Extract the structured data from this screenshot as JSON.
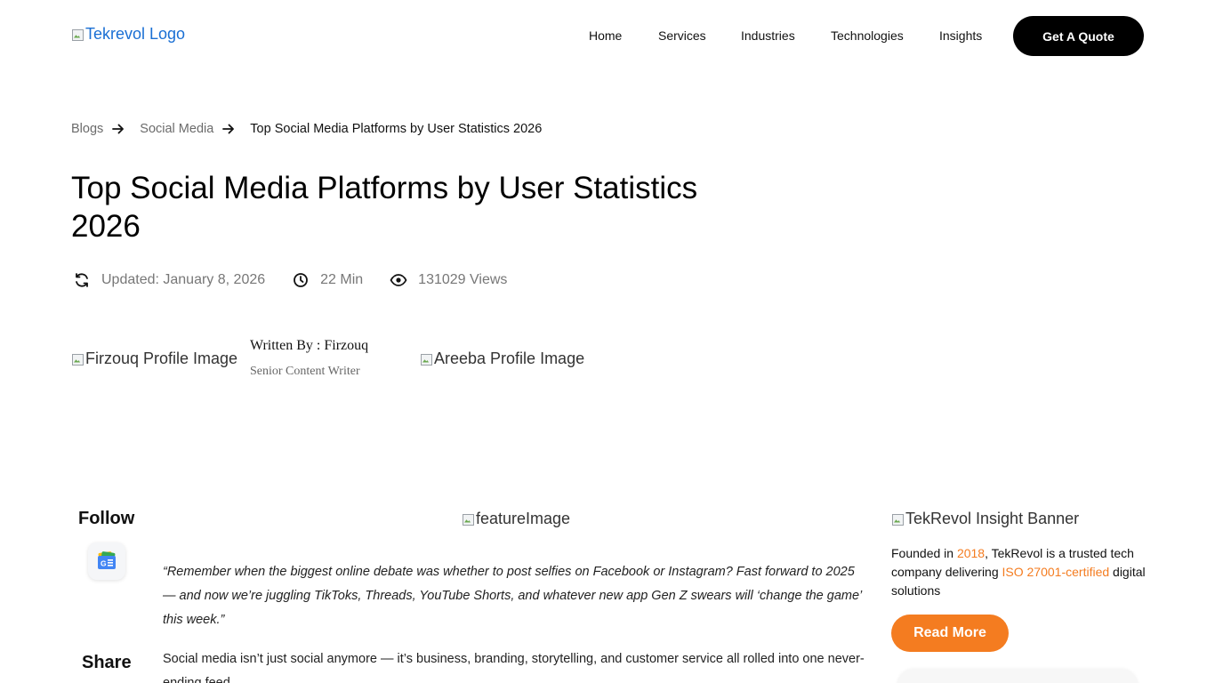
{
  "header": {
    "logo_alt": "Tekrevol Logo",
    "nav": [
      {
        "label": "Home"
      },
      {
        "label": "Services"
      },
      {
        "label": "Industries"
      },
      {
        "label": "Technologies"
      },
      {
        "label": "Insights"
      }
    ],
    "cta_label": "Get A Quote"
  },
  "breadcrumb": {
    "items": [
      "Blogs",
      "Social Media"
    ],
    "current": "Top Social Media Platforms by User Statistics 2026"
  },
  "article": {
    "title": "Top Social Media Platforms by User Statistics 2026",
    "updated": "Updated: January 8, 2026",
    "read_time": "22 Min",
    "views": "131029 Views",
    "author_image_alt": "Firzouq Profile Image",
    "author_name": "Written By : Firzouq",
    "author_role": "Senior Content Writer",
    "reviewer_image_alt": "Areeba Profile Image",
    "feature_image_alt": "featureImage",
    "quote": "“Remember when the biggest online debate was whether to post selfies on Facebook or Instagram? Fast forward to 2025 — and now we’re juggling TikToks, Threads, YouTube Shorts, and whatever new app Gen Z swears will ‘change the game’ this week.”",
    "body": "Social media isn’t just social anymore — it’s business, branding, storytelling, and customer service all rolled into one never-ending feed."
  },
  "social": {
    "follow_label": "Follow",
    "share_label": "Share",
    "follow_icon": "google-news-icon"
  },
  "sidebar": {
    "banner_alt": "TekRevol Insight Banner",
    "founded_prefix": "Founded in ",
    "founded_year": "2018",
    "founded_mid": ", TekRevol is a trusted tech company delivering ",
    "founded_cert": "ISO 27001-certified",
    "founded_suffix": " digital solutions",
    "read_more_label": "Read More"
  },
  "colors": {
    "accent": "#f47c20",
    "cta_bg": "#000000",
    "link": "#1a6fd4"
  }
}
